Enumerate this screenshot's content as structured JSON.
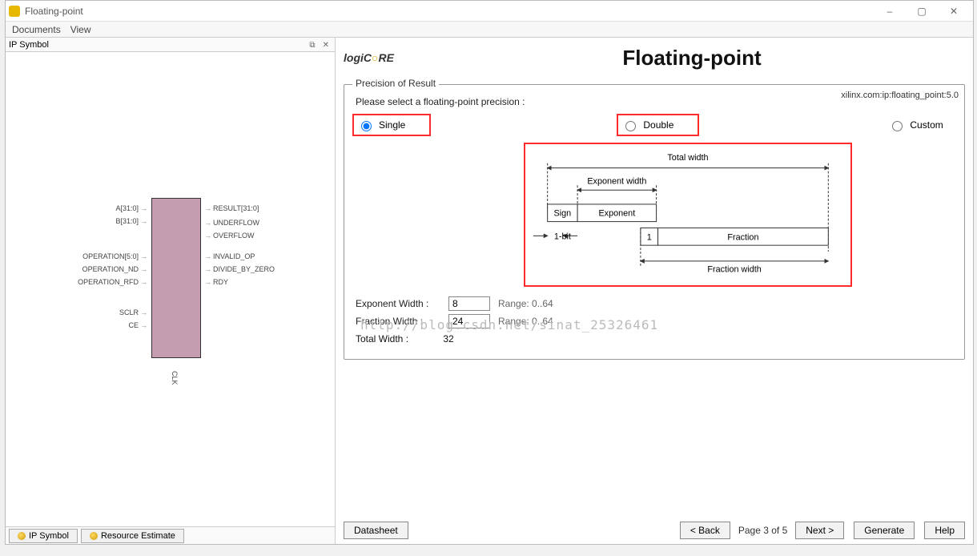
{
  "window": {
    "title": "Floating-point",
    "minimize": "–",
    "maximize": "▢",
    "close": "✕"
  },
  "menubar": {
    "documents": "Documents",
    "view": "View"
  },
  "left": {
    "panel_title": "IP Symbol",
    "pin": "⧉",
    "close": "✕",
    "ports_left": [
      "A[31:0]",
      "B[31:0]",
      "OPERATION[5:0]",
      "OPERATION_ND",
      "OPERATION_RFD",
      "SCLR",
      "CE"
    ],
    "ports_right": [
      "RESULT[31:0]",
      "UNDERFLOW",
      "OVERFLOW",
      "INVALID_OP",
      "DIVIDE_BY_ZERO",
      "RDY"
    ],
    "clk": "CLK",
    "tabs": {
      "ip_symbol": "IP Symbol",
      "resource_estimate": "Resource Estimate"
    }
  },
  "right": {
    "logo": "logiC",
    "logo_suffix": "RE",
    "title": "Floating-point",
    "ip_id": "xilinx.com:ip:floating_point:5.0",
    "fieldset_legend": "Precision of Result",
    "instruction": "Please select a floating-point precision :",
    "radios": {
      "single": "Single",
      "double": "Double",
      "custom": "Custom"
    },
    "diagram": {
      "total_width": "Total width",
      "exponent_width": "Exponent width",
      "sign": "Sign",
      "exponent": "Exponent",
      "one_bit": "1-bit",
      "one": "1",
      "fraction": "Fraction",
      "fraction_width": "Fraction width"
    },
    "fields": {
      "exp_label": "Exponent Width  :",
      "exp_value": "8",
      "exp_range": "Range: 0..64",
      "frac_label": "Fraction Width  :",
      "frac_value": "24",
      "frac_range": "Range: 0..64",
      "total_label": "Total Width  :",
      "total_value": "32"
    },
    "buttons": {
      "datasheet": "Datasheet",
      "back": "< Back",
      "page": "Page 3 of 5",
      "next": "Next >",
      "generate": "Generate",
      "help": "Help"
    },
    "watermark": "http://blog.csdn.net/sinat_25326461"
  }
}
